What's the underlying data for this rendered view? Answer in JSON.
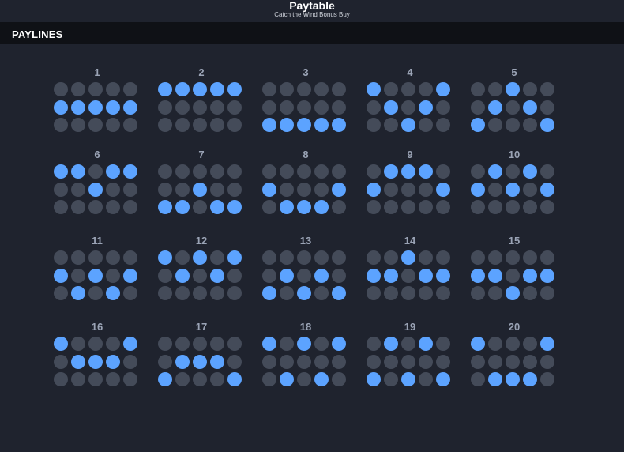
{
  "header": {
    "title": "Paytable",
    "subtitle": "Catch the Wind Bonus Buy"
  },
  "section": {
    "title": "PAYLINES"
  },
  "colors": {
    "active": "#5ca3ff",
    "inactive": "#444b59",
    "background": "#1f232e",
    "bar": "#0f1116"
  },
  "paylines": [
    {
      "label": "1",
      "rows": [
        1,
        1,
        1,
        1,
        1
      ]
    },
    {
      "label": "2",
      "rows": [
        0,
        0,
        0,
        0,
        0
      ]
    },
    {
      "label": "3",
      "rows": [
        2,
        2,
        2,
        2,
        2
      ]
    },
    {
      "label": "4",
      "rows": [
        0,
        1,
        2,
        1,
        0
      ]
    },
    {
      "label": "5",
      "rows": [
        2,
        1,
        0,
        1,
        2
      ]
    },
    {
      "label": "6",
      "rows": [
        0,
        0,
        1,
        0,
        0
      ]
    },
    {
      "label": "7",
      "rows": [
        2,
        2,
        1,
        2,
        2
      ]
    },
    {
      "label": "8",
      "rows": [
        1,
        2,
        2,
        2,
        1
      ]
    },
    {
      "label": "9",
      "rows": [
        1,
        0,
        0,
        0,
        1
      ]
    },
    {
      "label": "10",
      "rows": [
        1,
        0,
        1,
        0,
        1
      ]
    },
    {
      "label": "11",
      "rows": [
        1,
        2,
        1,
        2,
        1
      ]
    },
    {
      "label": "12",
      "rows": [
        0,
        1,
        0,
        1,
        0
      ]
    },
    {
      "label": "13",
      "rows": [
        2,
        1,
        2,
        1,
        2
      ]
    },
    {
      "label": "14",
      "rows": [
        1,
        1,
        0,
        1,
        1
      ]
    },
    {
      "label": "15",
      "rows": [
        1,
        1,
        2,
        1,
        1
      ]
    },
    {
      "label": "16",
      "rows": [
        0,
        1,
        1,
        1,
        0
      ]
    },
    {
      "label": "17",
      "rows": [
        2,
        1,
        1,
        1,
        2
      ]
    },
    {
      "label": "18",
      "rows": [
        0,
        2,
        0,
        2,
        0
      ]
    },
    {
      "label": "19",
      "rows": [
        2,
        0,
        2,
        0,
        2
      ]
    },
    {
      "label": "20",
      "rows": [
        0,
        2,
        2,
        2,
        0
      ]
    }
  ]
}
